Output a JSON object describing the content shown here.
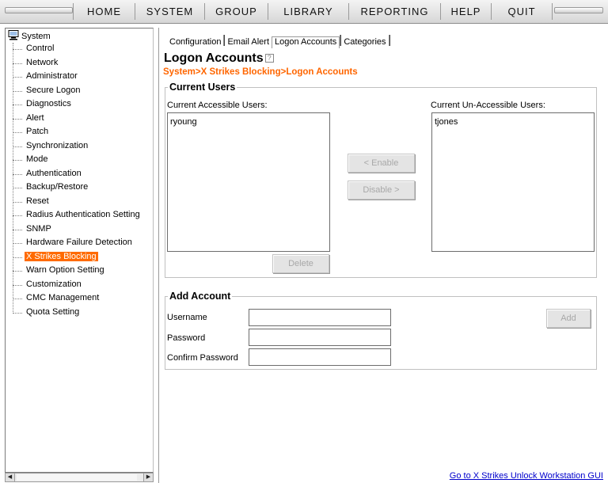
{
  "menu": {
    "items": [
      {
        "label": "HOME"
      },
      {
        "label": "SYSTEM"
      },
      {
        "label": "GROUP"
      },
      {
        "label": "LIBRARY"
      },
      {
        "label": "REPORTING"
      },
      {
        "label": "HELP"
      },
      {
        "label": "QUIT"
      }
    ]
  },
  "sidebar": {
    "root_label": "System",
    "items": [
      {
        "label": "Control"
      },
      {
        "label": "Network"
      },
      {
        "label": "Administrator"
      },
      {
        "label": "Secure Logon"
      },
      {
        "label": "Diagnostics"
      },
      {
        "label": "Alert"
      },
      {
        "label": "Patch"
      },
      {
        "label": "Synchronization"
      },
      {
        "label": "Mode"
      },
      {
        "label": "Authentication"
      },
      {
        "label": "Backup/Restore"
      },
      {
        "label": "Reset"
      },
      {
        "label": "Radius Authentication Setting"
      },
      {
        "label": "SNMP"
      },
      {
        "label": "Hardware Failure Detection"
      },
      {
        "label": "X Strikes Blocking"
      },
      {
        "label": "Warn Option Setting"
      },
      {
        "label": "Customization"
      },
      {
        "label": "CMC Management"
      },
      {
        "label": "Quota Setting"
      }
    ],
    "selected": "X Strikes Blocking"
  },
  "tabs": [
    {
      "label": "Configuration"
    },
    {
      "label": "Email Alert"
    },
    {
      "label": "Logon Accounts"
    },
    {
      "label": "Categories"
    }
  ],
  "active_tab": "Logon Accounts",
  "page": {
    "title": "Logon Accounts",
    "help_glyph": "?",
    "breadcrumb": "System>X Strikes Blocking>Logon Accounts"
  },
  "current_users": {
    "legend": "Current Users",
    "accessible_label": "Current Accessible Users:",
    "accessible_users": [
      "ryoung"
    ],
    "unaccessible_label": "Current Un-Accessible Users:",
    "unaccessible_users": [
      "tjones"
    ],
    "enable_button": "< Enable",
    "disable_button": "Disable >",
    "delete_button": "Delete"
  },
  "add_account": {
    "legend": "Add Account",
    "username_label": "Username",
    "password_label": "Password",
    "confirm_label": "Confirm Password",
    "username_value": "",
    "password_value": "",
    "confirm_value": "",
    "add_button": "Add"
  },
  "footer": {
    "link": "Go to X Strikes Unlock Workstation GUI"
  },
  "colors": {
    "accent": "#ff6600",
    "selected_bg": "#ff6a00",
    "link": "#0000cc"
  }
}
